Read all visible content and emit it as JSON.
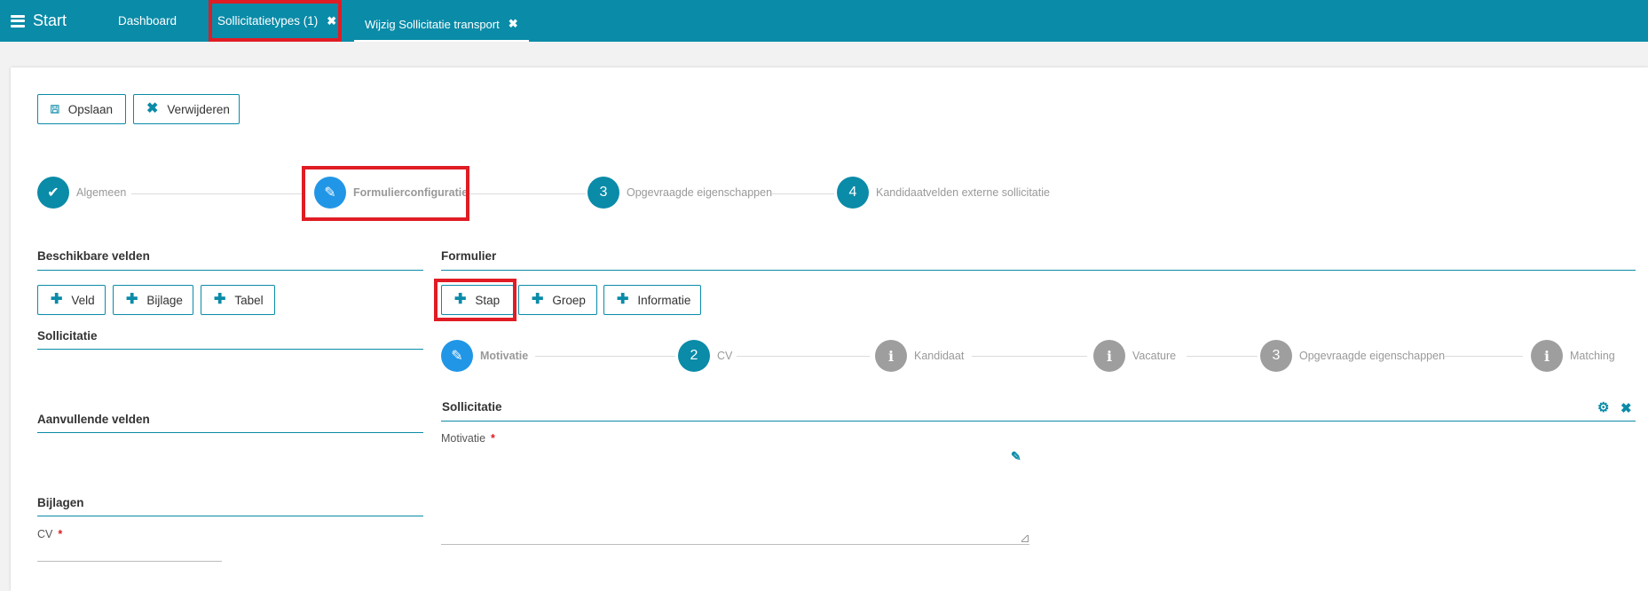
{
  "topbar": {
    "start_label": "Start",
    "tabs": [
      {
        "label": "Dashboard"
      },
      {
        "label": "Sollicitatietypes (1)",
        "close": "✖"
      },
      {
        "label": "Wijzig Sollicitatie transport",
        "close": "✖"
      }
    ]
  },
  "toolbar": {
    "save_label": "Opslaan",
    "delete_label": "Verwijderen"
  },
  "main_stepper": [
    {
      "label": "Algemeen",
      "marker": "✔",
      "state": "done"
    },
    {
      "label": "Formulierconfiguratie",
      "marker": "✎",
      "state": "active"
    },
    {
      "label": "Opgevraagde eigenschappen",
      "marker": "3",
      "state": "todo"
    },
    {
      "label": "Kandidaatvelden externe sollicitatie",
      "marker": "4",
      "state": "todo"
    }
  ],
  "available": {
    "title": "Beschikbare velden",
    "buttons": [
      "Veld",
      "Bijlage",
      "Tabel"
    ],
    "sections": [
      {
        "title": "Sollicitatie"
      },
      {
        "title": "Aanvullende velden"
      },
      {
        "title": "Bijlagen",
        "field": "CV"
      }
    ]
  },
  "form": {
    "title": "Formulier",
    "buttons": [
      "Stap",
      "Groep",
      "Informatie"
    ],
    "steps": [
      {
        "label": "Motivatie",
        "marker": "✎",
        "state": "active"
      },
      {
        "label": "CV",
        "marker": "2",
        "state": "todo"
      },
      {
        "label": "Kandidaat",
        "marker": "i",
        "state": "info"
      },
      {
        "label": "Vacature",
        "marker": "i",
        "state": "info"
      },
      {
        "label": "Opgevraagde eigenschappen",
        "marker": "3",
        "state": "info"
      },
      {
        "label": "Matching",
        "marker": "i",
        "state": "info"
      }
    ],
    "group_title": "Sollicitatie",
    "field_label": "Motivatie",
    "required_mark": "*"
  },
  "icons": {
    "menu": "hamburger-icon",
    "save": "floppy-icon",
    "delete": "close-icon",
    "add": "plus-icon",
    "edit": "pencil-icon",
    "settings": "gears-icon"
  },
  "colors": {
    "brand": "#0a8ba8",
    "active_step": "#2196e6",
    "inactive_step": "#9e9e9e",
    "highlight": "#e01c24"
  }
}
